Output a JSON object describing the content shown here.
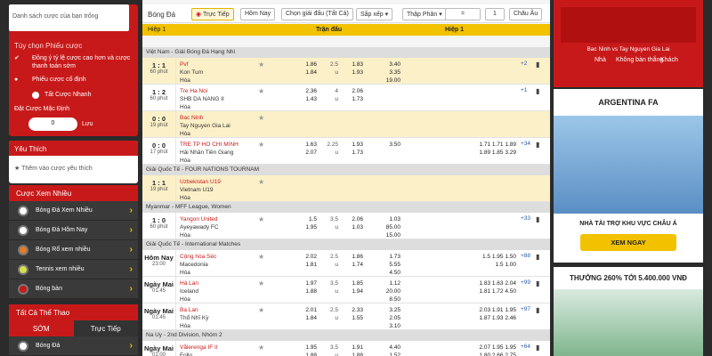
{
  "left": {
    "search_placeholder": "Danh sách cược của bạn trống",
    "options_title": "Tùy chọn Phiếu cược",
    "opt1": "Đồng ý tỷ lệ cược cao hơn và cược thanh toán sớm",
    "opt2": "Phiếu cược cố định",
    "opt3": "Tất Cược Nhanh",
    "default_label": "Đặt Cược Mặc Định",
    "default_value": "0",
    "save": "Lưu",
    "fav_title": "Yêu Thích",
    "fav_add": "Thêm vào cược yêu thích",
    "popular_title": "Cược Xem Nhiều",
    "popular": [
      "Bóng Đá Xem Nhiều",
      "Bóng Đá Hôm Nay",
      "Bóng Rổ xem nhiều",
      "Tennis xem nhiều",
      "Bóng bàn"
    ],
    "all_title": "Tất Cả Thể Thao",
    "tab_early": "SỚM",
    "tab_live": "Trực Tiếp",
    "sport": "Bóng Đá"
  },
  "center": {
    "title": "Bóng Đá",
    "tabs": [
      "Trực Tiếp",
      "Hôm Nay",
      "Chọn giải đấu (Tất Cả)",
      "Sắp xếp",
      "Thập Phân",
      "=",
      "1",
      "Châu Âu"
    ],
    "col_half1": "Hiệp 1",
    "col_full": "Trận đấu",
    "col_h1": "Hiệp 1",
    "sub": [
      "Cược Chấp",
      "O/U",
      "1x2",
      "Cược Chấp",
      "O/U",
      "1x2"
    ],
    "leagues": [
      {
        "name": "Việt Nam - Giải Bóng Đá Hạng Nhì",
        "matches": [
          {
            "score": "1 : 1",
            "min": "60 phút",
            "t1": "Pvf",
            "t2": "Kon Tum",
            "dr": "Hòa",
            "o1": "1.86",
            "o2": "1.84",
            "u1": "2.5",
            "u2": "u",
            "u3": "1.83",
            "u4": "1.93",
            "x1": "3.40",
            "x2": "3.35",
            "x3": "19.00",
            "more": "+2",
            "hl": true
          },
          {
            "score": "1 : 2",
            "min": "60 phút",
            "t1": "Tre Ha Noi",
            "t2": "SHB DA NANG II",
            "dr": "Hòa",
            "o1": "2.36",
            "o2": "1.43",
            "u1": "4",
            "u2": "u",
            "u3": "2.06",
            "u4": "1.73",
            "x1": "",
            "x2": "",
            "x3": "",
            "more": "+1",
            "hl": false
          },
          {
            "score": "0 : 0",
            "min": "19 phút",
            "t1": "Bac Ninh",
            "t2": "Tay Nguyen Gia Lai",
            "dr": "Hòa",
            "o1": "",
            "o2": "",
            "u1": "",
            "u2": "",
            "u3": "",
            "u4": "",
            "x1": "",
            "x2": "",
            "x3": "",
            "more": "",
            "hl": true
          },
          {
            "score": "0 : 0",
            "min": "17 phút",
            "t1": "TRE TP HO CHI MINH",
            "t2": "Hải Nhân Tiền Giang",
            "dr": "Hòa",
            "o1": "1.63",
            "o2": "2.07",
            "u1": "2.25",
            "u2": "u",
            "u3": "1.93",
            "u4": "1.73",
            "x1": "",
            "x2": "",
            "x3": "3.50",
            "more": "+34",
            "hl": false
          }
        ]
      },
      {
        "name": "Giải Quốc Tế - FOUR NATIONS TOURNAM",
        "matches": [
          {
            "score": "1 : 1",
            "min": "19 phút",
            "t1": "Uzbekistan U19",
            "t2": "Vietnam U19",
            "dr": "Hòa",
            "o1": "",
            "o2": "",
            "u1": "",
            "u2": "",
            "u3": "",
            "u4": "",
            "x1": "",
            "x2": "",
            "x3": "",
            "more": "",
            "hl": true
          }
        ]
      },
      {
        "name": "Myanmar - MFF League, Women",
        "matches": [
          {
            "score": "1 : 0",
            "min": "60 phút",
            "t1": "Yangon United",
            "t2": "Ayeyawady FC",
            "dr": "Hòa",
            "o1": "1.5",
            "o2": "1.95",
            "u1": "3.5",
            "u2": "u",
            "u3": "2.06",
            "u4": "1.03",
            "x1": "1.03",
            "x2": "85.00",
            "x3": "15.00",
            "more": "+33",
            "hl": false
          }
        ]
      },
      {
        "name": "Giải Quốc Tế - International Matches",
        "matches": [
          {
            "score": "Hôm Nay",
            "min": "23:00",
            "t1": "Cộng hòa Séc",
            "t2": "Macedonia",
            "dr": "Hòa",
            "o1": "2.02",
            "o2": "1.81",
            "u1": "2.5",
            "u2": "u",
            "u3": "1.86",
            "u4": "1.74",
            "x1": "1.73",
            "x2": "5.55",
            "x3": "4.50",
            "more": "+88",
            "hl": false
          },
          {
            "score": "Ngày Mai",
            "min": "01:45",
            "t1": "Hà Lan",
            "t2": "Iceland",
            "dr": "Hòa",
            "o1": "1.97",
            "o2": "1.88",
            "u1": "3.5",
            "u2": "u",
            "u3": "1.85",
            "u4": "1.94",
            "x1": "1.12",
            "x2": "20.00",
            "x3": "8.50",
            "more": "+99",
            "hl": false
          },
          {
            "score": "Ngày Mai",
            "min": "01:45",
            "t1": "Ba Lan",
            "t2": "Thổ Nhĩ Kỳ",
            "dr": "Hòa",
            "o1": "2.01",
            "o2": "1.84",
            "u1": "2.5",
            "u2": "u",
            "u3": "2.33",
            "u4": "1.55",
            "x1": "3.25",
            "x2": "2.05",
            "x3": "3.10",
            "more": "+97",
            "hl": false
          }
        ]
      },
      {
        "name": "Na Uy - 2nd Division, Nhóm 2",
        "matches": [
          {
            "score": "Ngày Mai",
            "min": "01:00",
            "t1": "Vålerenga IF II",
            "t2": "Follo",
            "dr": "Hòa",
            "o1": "1.95",
            "o2": "1.88",
            "u1": "3.5",
            "u2": "u",
            "u3": "1.91",
            "u4": "1.88",
            "x1": "4.40",
            "x2": "1.52",
            "x3": "3.70",
            "more": "+64",
            "hl": false
          }
        ]
      }
    ],
    "h1odds": [
      [
        "",
        "",
        "",
        "",
        "",
        "",
        "",
        "",
        ""
      ],
      [
        "",
        "",
        "",
        "",
        "",
        "",
        "",
        "",
        ""
      ],
      [
        "",
        "",
        "",
        "",
        "",
        "",
        "",
        "",
        ""
      ],
      [
        "1.71",
        "1.89",
        "1.05",
        "1.05",
        "1.71",
        "1.19",
        "1.89",
        "1.85",
        "3.29"
      ],
      [
        "",
        "",
        "",
        "",
        "",
        "",
        "",
        "",
        ""
      ],
      [
        "",
        "",
        "",
        "",
        "",
        "",
        "",
        "",
        ""
      ],
      [
        "1.5",
        "1.5",
        "0.5",
        "1.03",
        "1.95",
        "u",
        "1.50",
        "",
        "1.00"
      ],
      [
        "1.83",
        "1.81",
        "1.5",
        "1.08",
        "1.63",
        "u",
        "2.04",
        "1.72",
        "4.50"
      ],
      [
        "2.03",
        "1.87",
        "1.5",
        "1.29",
        "1.91",
        "u",
        "1.95",
        "1.93",
        "2.46"
      ],
      [
        "2.07",
        "1.80",
        "1",
        "1.91",
        "1.95",
        "u",
        "1.95",
        "2.66",
        "2.75"
      ],
      [
        "1.81",
        "1.86",
        "1.5",
        "1.86",
        "1.85",
        "u",
        "1.96",
        "2.62",
        "2.04"
      ]
    ]
  },
  "right": {
    "score_title": "Bac Ninh vs Tay Nguyen Gia Lai",
    "score_tabs": [
      "Nhà",
      "Không bàn thắng",
      "Khách"
    ],
    "promo_title": "ARGENTINA FA",
    "promo_sub": "NHÀ TÀI TRỢ KHU VỰC CHÂU Á",
    "promo_btn": "XEM NGAY",
    "promo2": "THƯỞNG 260% TỚI 5.400.000 VNĐ"
  }
}
